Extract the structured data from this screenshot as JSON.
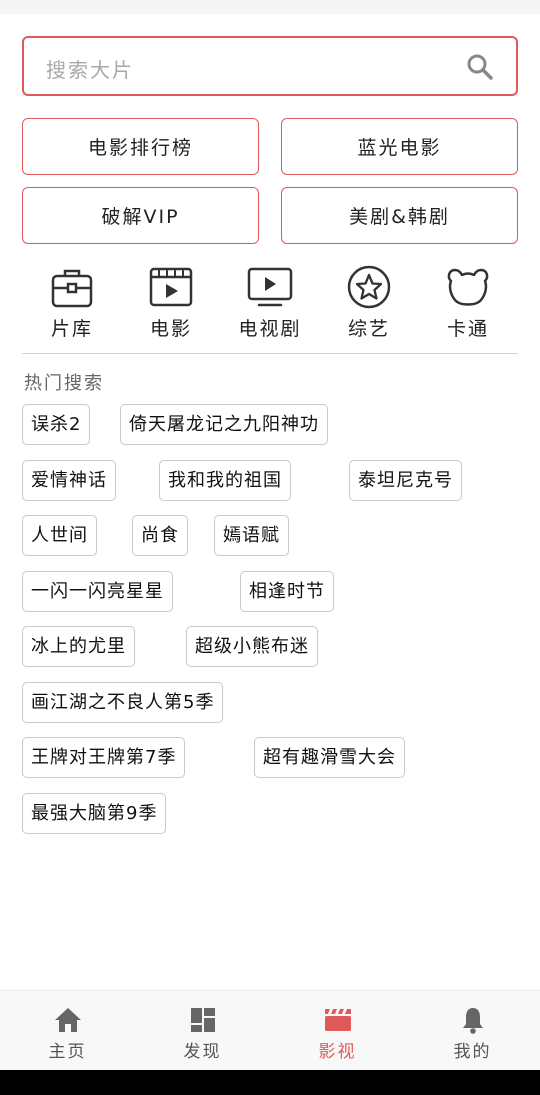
{
  "search": {
    "placeholder": "搜索大片"
  },
  "quick_links": [
    "电影排行榜",
    "蓝光电影",
    "破解VIP",
    "美剧&韩剧"
  ],
  "categories": [
    "片库",
    "电影",
    "电视剧",
    "综艺",
    "卡通"
  ],
  "hot": {
    "title": "热门搜索",
    "tags": [
      "误杀2",
      "倚天屠龙记之九阳神功",
      "爱情神话",
      "我和我的祖国",
      "泰坦尼克号",
      "人世间",
      "尚食",
      "嫣语赋",
      "一闪一闪亮星星",
      "相逢时节",
      "冰上的尤里",
      "超级小熊布迷",
      "画江湖之不良人第5季",
      "王牌对王牌第7季",
      "超有趣滑雪大会",
      "最强大脑第9季"
    ]
  },
  "nav": {
    "items": [
      "主页",
      "发现",
      "影视",
      "我的"
    ],
    "active": "影视"
  },
  "colors": {
    "accent": "#e05a5a"
  }
}
